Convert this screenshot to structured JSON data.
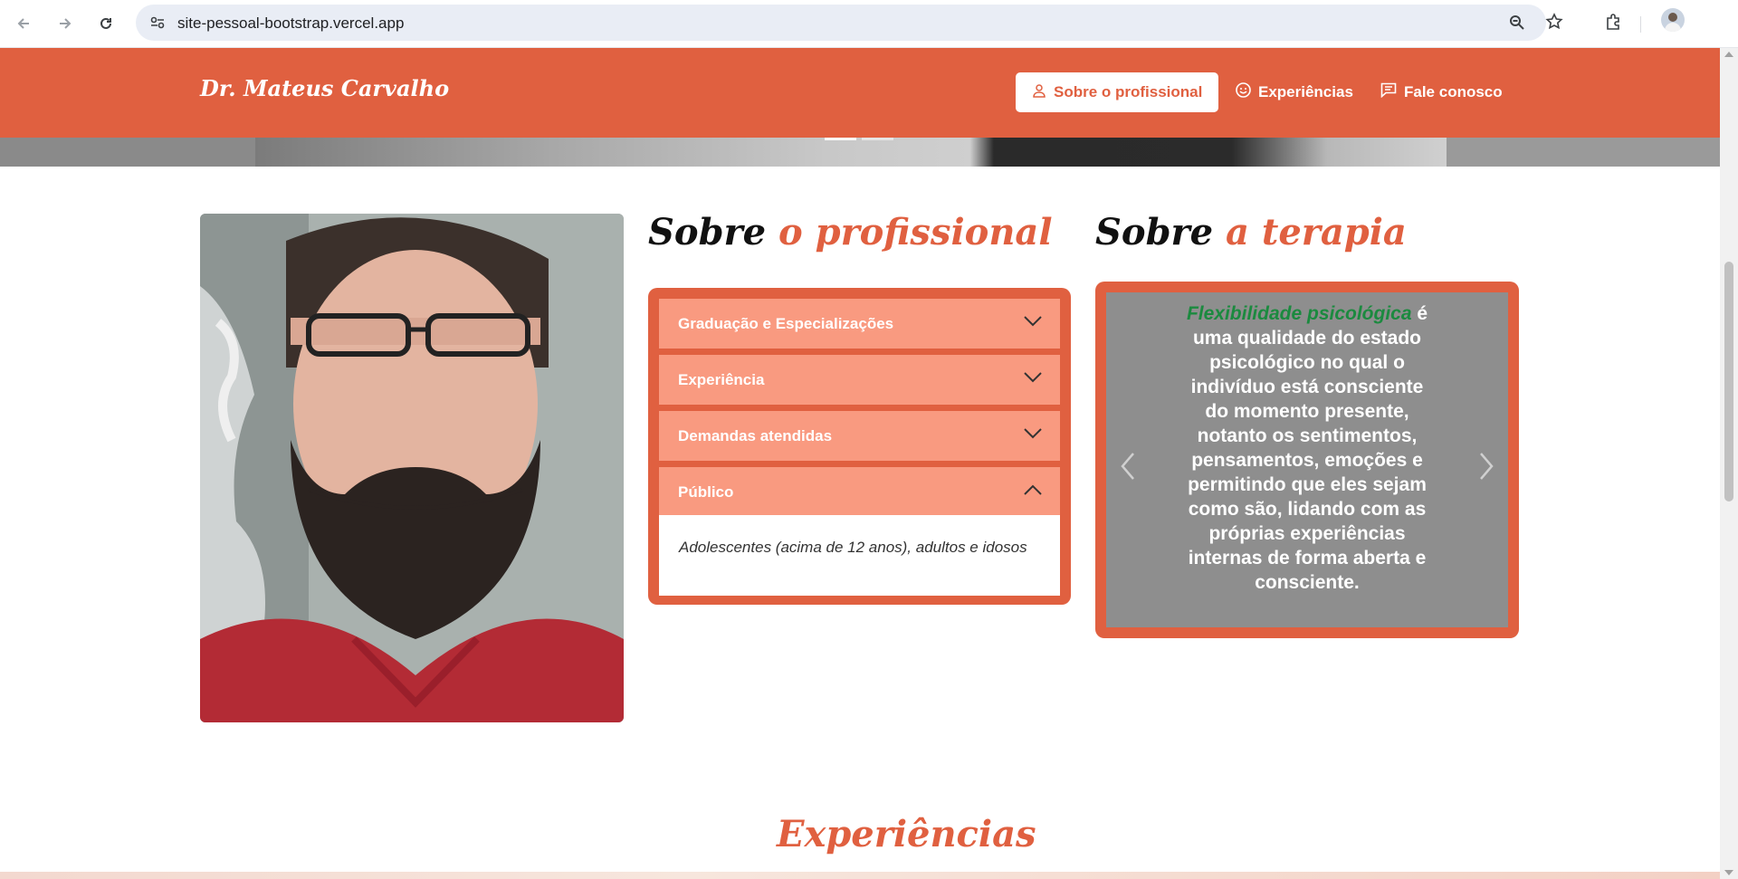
{
  "browser": {
    "url": "site-pessoal-bootstrap.vercel.app",
    "icons": [
      "back-arrow-icon",
      "forward-arrow-icon",
      "reload-icon",
      "site-info-icon",
      "zoom-icon",
      "bookmark-star-icon",
      "extensions-icon",
      "profile-avatar"
    ]
  },
  "header": {
    "brand": "Dr. Mateus Carvalho",
    "nav": [
      {
        "label": "Sobre o profissional",
        "icon": "person-icon",
        "active": true
      },
      {
        "label": "Experiências",
        "icon": "smile-icon",
        "active": false
      },
      {
        "label": "Fale conosco",
        "icon": "chat-icon",
        "active": false
      }
    ]
  },
  "about": {
    "heading_part1": "Sobre",
    "heading_part2": "o profissional",
    "accordion": [
      {
        "label": "Graduação e Especializações",
        "expanded": false
      },
      {
        "label": "Experiência",
        "expanded": false
      },
      {
        "label": "Demandas atendidas",
        "expanded": false
      },
      {
        "label": "Público",
        "expanded": true
      }
    ],
    "expanded_text": "Adolescentes (acima de 12 anos), adultos e idosos"
  },
  "therapy": {
    "heading_part1": "Sobre",
    "heading_part2": "a terapia",
    "highlight": "Flexibilidade psicológica",
    "text": " é uma qualidade do estado psicológico no qual o indivíduo está consciente do momento presente, notanto os sentimentos, pensamentos, emoções e permitindo que eles sejam como são, lidando com as próprias experiências internas de forma aberta e consciente."
  },
  "experiences_heading": "Experiências",
  "colors": {
    "brand": "#e06040",
    "accordion_item": "#f99a80",
    "carousel_bg": "#8e8e8e",
    "highlight_green": "#1b8a3f"
  }
}
